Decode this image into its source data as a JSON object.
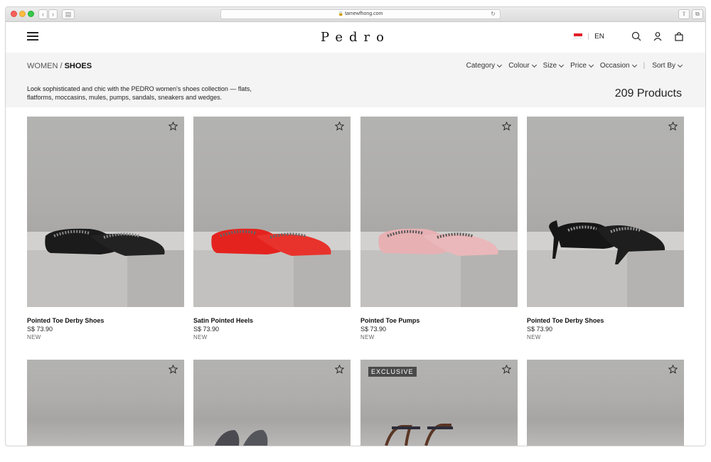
{
  "browser": {
    "url": "tamewfhong.com"
  },
  "header": {
    "logo": "Pedro",
    "language": "EN",
    "flag_color": "#e2202a"
  },
  "breadcrumb": {
    "parent": "WOMEN",
    "separator": " / ",
    "current": "SHOES"
  },
  "filters": [
    {
      "label": "Category"
    },
    {
      "label": "Colour"
    },
    {
      "label": "Size"
    },
    {
      "label": "Price"
    },
    {
      "label": "Occasion"
    }
  ],
  "sort_label": "Sort By",
  "description": "Look sophisticated and chic with the PEDRO women's shoes collection — flats, flatforms, moccasins, mules, pumps, sandals, sneakers and wedges.",
  "product_count": "209 Products",
  "products": [
    {
      "name": "Pointed Toe Derby Shoes",
      "price": "S$ 73.90",
      "badge": "NEW",
      "color": "#1b1b1b"
    },
    {
      "name": "Satin Pointed Heels",
      "price": "S$ 73.90",
      "badge": "NEW",
      "color": "#e4231f"
    },
    {
      "name": "Pointed Toe Pumps",
      "price": "S$ 73.90",
      "badge": "NEW",
      "color": "#e7b1b4"
    },
    {
      "name": "Pointed Toe Derby Shoes",
      "price": "S$ 73.90",
      "badge": "NEW",
      "color": "#161616"
    }
  ],
  "exclusive_label": "EXCLUSIVE",
  "colors": {
    "filter_bar_bg": "#f4f4f4",
    "image_bg": "#aeadab"
  }
}
